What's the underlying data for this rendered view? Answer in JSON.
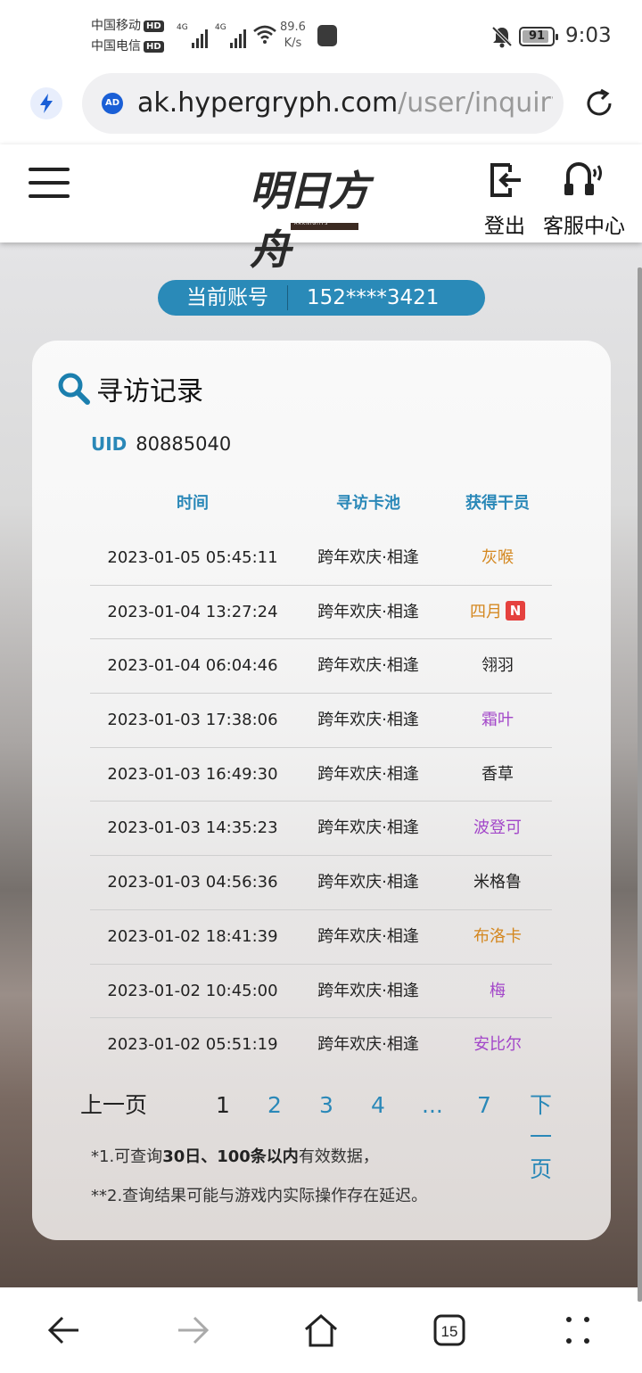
{
  "status_bar": {
    "carrier1": "中国移动",
    "carrier2": "中国电信",
    "hd_badge": "HD",
    "network1": "4G",
    "network2": "4G",
    "speed_value": "89.6",
    "speed_unit": "K/s",
    "battery": "91",
    "battery_level": 0.91,
    "time": "9:03"
  },
  "browser": {
    "url_host": "ak.hypergryph.com",
    "url_path": "/user/inquiryG",
    "ad_icon": "AD",
    "tab_count": "15"
  },
  "header": {
    "logo_text": "明日方舟",
    "logo_sub": "ARKNIGHTS",
    "logout_label": "登出",
    "support_label": "客服中心"
  },
  "account": {
    "label": "当前账号",
    "value": "152****3421"
  },
  "card": {
    "title": "寻访记录",
    "uid_label": "UID",
    "uid_value": "80885040",
    "columns": [
      "时间",
      "寻访卡池",
      "获得干员"
    ],
    "rows": [
      {
        "time": "2023-01-05 05:45:11",
        "pool": "跨年欢庆·相逢",
        "operator": "灰喉",
        "color": "#d4871f",
        "is_new": false
      },
      {
        "time": "2023-01-04 13:27:24",
        "pool": "跨年欢庆·相逢",
        "operator": "四月",
        "color": "#d4871f",
        "is_new": true
      },
      {
        "time": "2023-01-04 06:04:46",
        "pool": "跨年欢庆·相逢",
        "operator": "翎羽",
        "color": "#222222",
        "is_new": false
      },
      {
        "time": "2023-01-03 17:38:06",
        "pool": "跨年欢庆·相逢",
        "operator": "霜叶",
        "color": "#a347c9",
        "is_new": false
      },
      {
        "time": "2023-01-03 16:49:30",
        "pool": "跨年欢庆·相逢",
        "operator": "香草",
        "color": "#222222",
        "is_new": false
      },
      {
        "time": "2023-01-03 14:35:23",
        "pool": "跨年欢庆·相逢",
        "operator": "波登可",
        "color": "#a347c9",
        "is_new": false
      },
      {
        "time": "2023-01-03 04:56:36",
        "pool": "跨年欢庆·相逢",
        "operator": "米格鲁",
        "color": "#222222",
        "is_new": false
      },
      {
        "time": "2023-01-02 18:41:39",
        "pool": "跨年欢庆·相逢",
        "operator": "布洛卡",
        "color": "#d4871f",
        "is_new": false
      },
      {
        "time": "2023-01-02 10:45:00",
        "pool": "跨年欢庆·相逢",
        "operator": "梅",
        "color": "#a347c9",
        "is_new": false
      },
      {
        "time": "2023-01-02 05:51:19",
        "pool": "跨年欢庆·相逢",
        "operator": "安比尔",
        "color": "#a347c9",
        "is_new": false
      }
    ],
    "new_badge": "N",
    "pager": {
      "prev": "上一页",
      "pages": [
        "1",
        "2",
        "3",
        "4",
        "...",
        "7"
      ],
      "current": "1",
      "next": "下一页"
    },
    "notes": {
      "n1_prefix": "*1.可查询",
      "n1_bold": "30日、100条以内",
      "n1_suffix": "有效数据，",
      "n2": "**2.查询结果可能与游戏内实际操作存在延迟。"
    }
  },
  "colors": {
    "accent": "#2a88b8",
    "pill": "#2a8ab8",
    "badge": "#e5413e",
    "gold": "#d4871f",
    "purple": "#a347c9"
  },
  "icons": [
    "bolt-icon",
    "ad-icon",
    "reload-icon",
    "menu-icon",
    "logout-icon",
    "support-icon",
    "search-icon",
    "back-icon",
    "forward-icon",
    "home-icon",
    "tabs-icon",
    "more-icon"
  ]
}
